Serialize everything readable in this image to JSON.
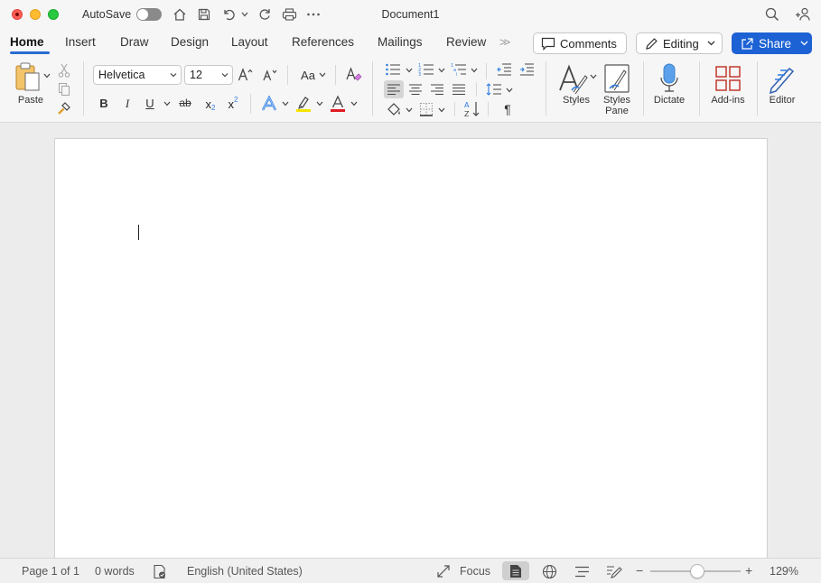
{
  "window": {
    "autosave_label": "AutoSave",
    "autosave_on": false,
    "document_title": "Document1"
  },
  "tabs": [
    {
      "label": "Home",
      "active": true
    },
    {
      "label": "Insert"
    },
    {
      "label": "Draw"
    },
    {
      "label": "Design"
    },
    {
      "label": "Layout"
    },
    {
      "label": "References"
    },
    {
      "label": "Mailings"
    },
    {
      "label": "Review"
    }
  ],
  "header_buttons": {
    "comments": "Comments",
    "editing": "Editing",
    "share": "Share"
  },
  "ribbon": {
    "paste_label": "Paste",
    "font_name": "Helvetica",
    "font_size": "12",
    "change_case_label": "Aa",
    "bold": "B",
    "italic": "I",
    "underline": "U",
    "strikethrough": "ab",
    "subscript": "x",
    "superscript": "x",
    "styles_label": "Styles",
    "styles_pane_label": "Styles Pane",
    "dictate_label": "Dictate",
    "addins_label": "Add-ins",
    "editor_label": "Editor"
  },
  "status": {
    "page": "Page 1 of 1",
    "words": "0 words",
    "language": "English (United States)",
    "focus": "Focus",
    "zoom": "129%",
    "zoom_minus": "−",
    "zoom_plus": "+"
  },
  "colors": {
    "accent": "#1d62d4",
    "tab_underline": "#2b6cd1",
    "highlight_bar": "#f5e400",
    "font_color_bar": "#e01b24",
    "text_effects": "#2f7de1"
  }
}
